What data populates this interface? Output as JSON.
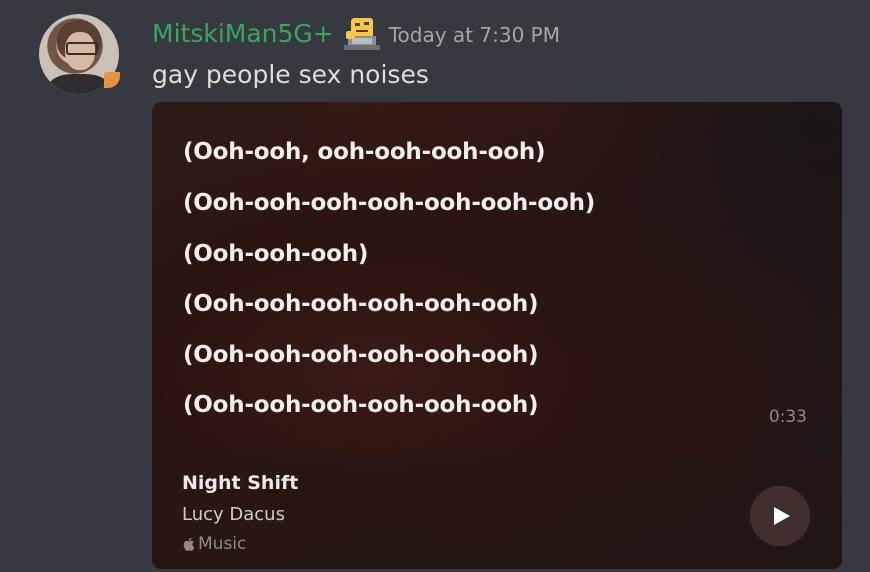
{
  "message": {
    "username": "MitskiMan5G+",
    "timestamp": "Today at 7:30 PM",
    "text": "gay people sex noises",
    "username_color": "#3ba55c",
    "badge_icon": "thinking-laptop-emoji"
  },
  "embed": {
    "lyrics": [
      "(Ooh-ooh, ooh-ooh-ooh-ooh)",
      "(Ooh-ooh-ooh-ooh-ooh-ooh-ooh)",
      "(Ooh-ooh-ooh)",
      "(Ooh-ooh-ooh-ooh-ooh-ooh)",
      "(Ooh-ooh-ooh-ooh-ooh-ooh)",
      "(Ooh-ooh-ooh-ooh-ooh-ooh)"
    ],
    "duration": "0:33",
    "track_title": "Night Shift",
    "artist": "Lucy Dacus",
    "service_label": "Music",
    "service_icon": "apple-icon",
    "play_icon": "play-icon"
  },
  "colors": {
    "background": "#36393f",
    "text": "#dcddde",
    "timestamp": "#a3a6aa"
  }
}
